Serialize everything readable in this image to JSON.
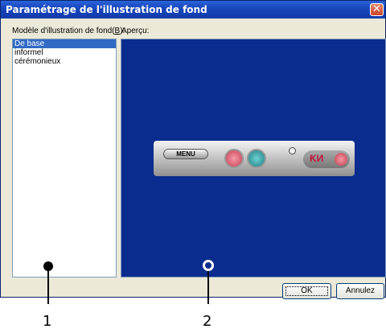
{
  "window": {
    "title": "Paramétrage de l'illustration de fond",
    "close_glyph": "✕"
  },
  "labels": {
    "model_prefix": "Modèle d'illustration de fond(",
    "model_key": "B",
    "model_suffix": "):",
    "preview": "Aperçu:"
  },
  "list": {
    "items": [
      "De base",
      "informel",
      "cérémonieux"
    ],
    "selected_index": 0
  },
  "preview_skin": {
    "menu_label": "MENU",
    "logo_text": "ƘИ"
  },
  "buttons": {
    "ok": "OK",
    "cancel": "Annulez"
  },
  "callouts": [
    "1",
    "2"
  ],
  "colors": {
    "titlebar": "#1848bf",
    "selection": "#316ac5",
    "preview_background": "#0a2c8e",
    "dialog_background": "#ece9d8"
  }
}
